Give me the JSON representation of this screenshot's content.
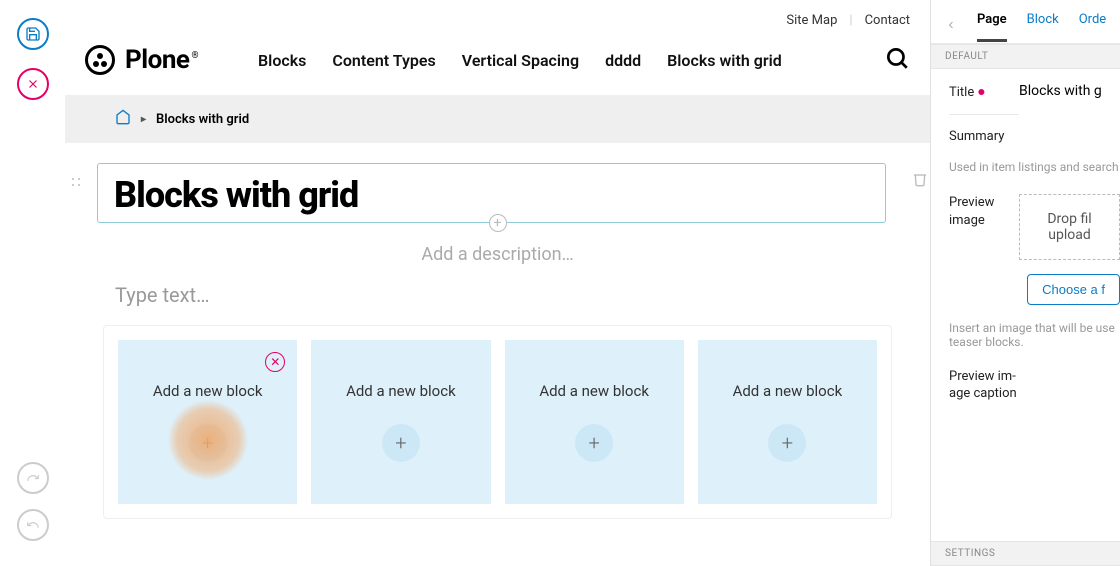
{
  "utility": {
    "sitemap": "Site Map",
    "contact": "Contact"
  },
  "brand": {
    "name": "Plone"
  },
  "nav": [
    "Blocks",
    "Content Types",
    "Vertical Spacing",
    "dddd",
    "Blocks with grid"
  ],
  "breadcrumb": {
    "current": "Blocks with grid"
  },
  "page_title": "Blocks with grid",
  "description_placeholder": "Add a description…",
  "text_placeholder": "Type text…",
  "grid": {
    "cells": [
      {
        "label": "Add a new block",
        "removable": true,
        "highlight": true
      },
      {
        "label": "Add a new block"
      },
      {
        "label": "Add a new block"
      },
      {
        "label": "Add a new block"
      }
    ]
  },
  "sidebar": {
    "tabs": {
      "page": "Page",
      "block": "Block",
      "order": "Orde"
    },
    "sections": {
      "default": "DEFAULT",
      "settings": "SETTINGS"
    },
    "fields": {
      "title": {
        "label": "Title",
        "value": "Blocks with g"
      },
      "summary": {
        "label": "Summary",
        "help": "Used in item listings and search"
      },
      "preview_image": {
        "label": "Preview image",
        "drop": "Drop fil\nupload ",
        "choose": "Choose a f",
        "help": "Insert an image that will be use\nteaser blocks."
      },
      "preview_caption": {
        "label": "Preview im-\nage caption"
      }
    }
  }
}
